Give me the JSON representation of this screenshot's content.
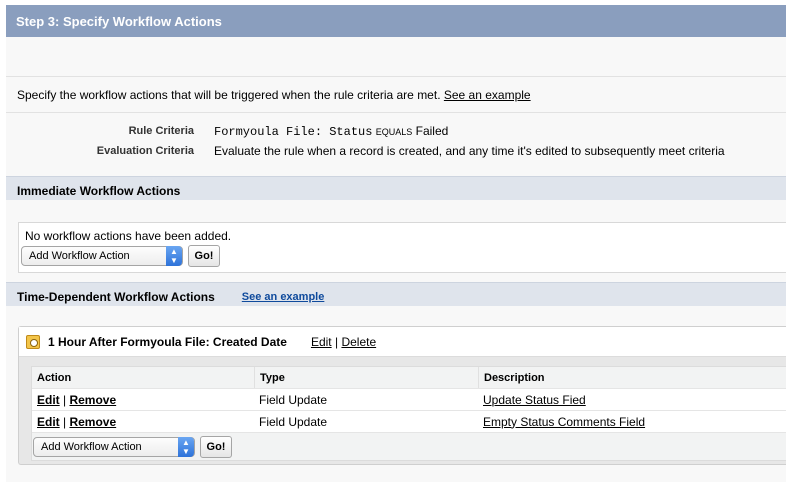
{
  "header": {
    "title": "Step 3: Specify Workflow Actions"
  },
  "intro": {
    "text": "Specify the workflow actions that will be triggered when the rule criteria are met.",
    "link": "See an example"
  },
  "criteria": {
    "rule_label": "Rule Criteria",
    "rule_field": "Formyoula File: Status",
    "rule_operator": "EQUALS",
    "rule_value": "Failed",
    "eval_label": "Evaluation Criteria",
    "eval_value": "Evaluate the rule when a record is created, and any time it's edited to subsequently meet criteria"
  },
  "immediate": {
    "title": "Immediate Workflow Actions",
    "empty_message": "No workflow actions have been added.",
    "select_value": "Add Workflow Action",
    "go_label": "Go!"
  },
  "time_dependent": {
    "title": "Time-Dependent Workflow Actions",
    "link": "See an example",
    "trigger": {
      "title": "1 Hour After Formyoula File: Created Date",
      "edit": "Edit",
      "separator": "|",
      "delete": "Delete"
    },
    "table": {
      "columns": [
        "Action",
        "Type",
        "Description"
      ],
      "rows": [
        {
          "edit": "Edit",
          "remove": "Remove",
          "type": "Field Update",
          "description": "Update Status Fied"
        },
        {
          "edit": "Edit",
          "remove": "Remove",
          "type": "Field Update",
          "description": "Empty Status Comments Field"
        }
      ]
    },
    "select_value": "Add Workflow Action",
    "go_label": "Go!"
  },
  "colors": {
    "header_bg": "#8a9ebe",
    "section_bg": "#dfe4ec",
    "link_blue": "#0f4a9c"
  },
  "icons": {
    "trigger": "clock-icon",
    "select_arrow": "chevron-updown-icon"
  }
}
